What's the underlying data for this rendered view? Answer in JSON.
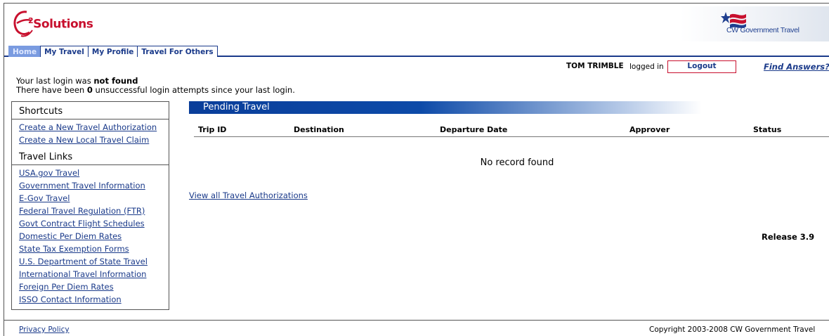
{
  "header": {
    "brand": "Solutions",
    "brand_super": "2",
    "partner": "CW Government Travel"
  },
  "nav": {
    "tabs": [
      "Home",
      "My Travel",
      "My Profile",
      "Travel For Others"
    ]
  },
  "user": {
    "name": "TOM TRIMBLE",
    "status": "logged in",
    "logout_label": "Logout",
    "help_link": "Find Answers?"
  },
  "login_info": {
    "line1_prefix": "Your last login was ",
    "line1_bold": "not found",
    "line2_prefix": "There have been ",
    "line2_bold": "0",
    "line2_suffix": " unsuccessful login attempts since your last login."
  },
  "sidebar": {
    "shortcuts_title": "Shortcuts",
    "shortcuts": [
      "Create a New Travel Authorization",
      "Create a New Local Travel Claim"
    ],
    "links_title": "Travel Links",
    "links": [
      "USA.gov Travel",
      "Government Travel Information",
      "E-Gov Travel",
      "Federal Travel Regulation (FTR)",
      "Govt Contract Flight Schedules",
      "Domestic Per Diem Rates",
      "State Tax Exemption Forms",
      "U.S. Department of State Travel",
      "International Travel Information",
      "Foreign Per Diem Rates",
      "ISSO Contact Information"
    ]
  },
  "pending": {
    "title": "Pending Travel",
    "columns": [
      "Trip ID",
      "Destination",
      "Departure Date",
      "Approver",
      "Status"
    ],
    "empty_message": "No record found",
    "view_all": "View all Travel Authorizations"
  },
  "release": "Release 3.9",
  "footer": {
    "privacy": "Privacy Policy",
    "copyright": "Copyright 2003-2008 CW Government Travel"
  },
  "colors": {
    "brand_red": "#c8102e",
    "nav_blue": "#1a3a8a",
    "pending_bar": "#0a3e9a"
  }
}
